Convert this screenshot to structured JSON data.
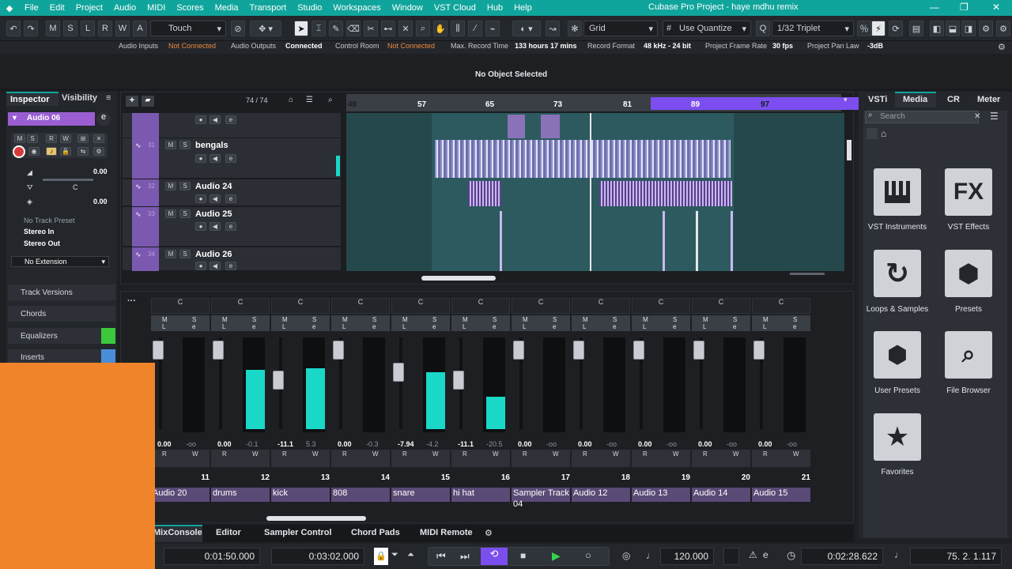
{
  "menu": [
    "File",
    "Edit",
    "Project",
    "Audio",
    "MIDI",
    "Scores",
    "Media",
    "Transport",
    "Studio",
    "Workspaces",
    "Window",
    "VST Cloud",
    "Hub",
    "Help"
  ],
  "window_title": "Cubase Pro Project - haye mdhu remix",
  "toolbar": {
    "ms_buttons": [
      "M",
      "S",
      "L",
      "R",
      "W",
      "A"
    ],
    "automation_mode": "Touch",
    "snap_type": "Grid",
    "quantize_mode": "Use Quantize",
    "quantize_value": "1/32 Triplet"
  },
  "status": {
    "audio_inputs_label": "Audio Inputs",
    "audio_inputs_value": "Not Connected",
    "audio_outputs_label": "Audio Outputs",
    "audio_outputs_value": "Connected",
    "control_room_label": "Control Room",
    "control_room_value": "Not Connected",
    "max_record_label": "Max. Record Time",
    "max_record_value": "133 hours 17 mins",
    "record_format_label": "Record Format",
    "record_format_value": "48 kHz - 24 bit",
    "frame_rate_label": "Project Frame Rate",
    "frame_rate_value": "30 fps",
    "pan_law_label": "Project Pan Law",
    "pan_law_value": "-3dB"
  },
  "info_line": "No Object Selected",
  "inspector": {
    "tab_inspector": "Inspector",
    "tab_visibility": "Visibility",
    "track_name": "Audio 06",
    "volume": "0.00",
    "pan_value": "C",
    "vol2": "0.00",
    "track_preset": "No Track Preset",
    "input": "Stereo In",
    "output": "Stereo Out",
    "extension": "No Extension",
    "sections": [
      "Track Versions",
      "Chords",
      "Equalizers",
      "Inserts"
    ]
  },
  "project": {
    "track_count": "74 / 74",
    "ruler_bars": [
      "49",
      "57",
      "65",
      "73",
      "81",
      "89",
      "97"
    ],
    "tracks": [
      {
        "name": "",
        "number": ""
      },
      {
        "name": "bengals",
        "number": "31"
      },
      {
        "name": "Audio 24",
        "number": "32"
      },
      {
        "name": "Audio 25",
        "number": "33"
      },
      {
        "name": "Audio 26",
        "number": "34"
      }
    ]
  },
  "mixer": {
    "channels": [
      {
        "name": "Audio 20",
        "number": "11",
        "pan": "C",
        "vol": "0.00",
        "peak": "-oo",
        "fader": 0.05,
        "level": 0.0
      },
      {
        "name": "drums",
        "number": "12",
        "pan": "C",
        "vol": "0.00",
        "peak": "-0.1",
        "fader": 0.05,
        "level": 0.65
      },
      {
        "name": "kick",
        "number": "13",
        "pan": "C",
        "vol": "-11.1",
        "peak": "5.3",
        "fader": 0.52,
        "level": 0.66
      },
      {
        "name": "808",
        "number": "14",
        "pan": "C",
        "vol": "0.00",
        "peak": "-0.3",
        "fader": 0.05,
        "level": 0.0
      },
      {
        "name": "snare",
        "number": "15",
        "pan": "C",
        "vol": "-7.94",
        "peak": "-4.2",
        "fader": 0.4,
        "level": 0.62
      },
      {
        "name": "hi hat",
        "number": "16",
        "pan": "C",
        "vol": "-11.1",
        "peak": "-20.5",
        "fader": 0.52,
        "level": 0.35
      },
      {
        "name": "Sampler Track 04",
        "number": "17",
        "pan": "C",
        "vol": "0.00",
        "peak": "-oo",
        "fader": 0.05,
        "level": 0.0
      },
      {
        "name": "Audio 12",
        "number": "18",
        "pan": "C",
        "vol": "0.00",
        "peak": "-oo",
        "fader": 0.05,
        "level": 0.0
      },
      {
        "name": "Audio 13",
        "number": "19",
        "pan": "C",
        "vol": "0.00",
        "peak": "-oo",
        "fader": 0.05,
        "level": 0.0
      },
      {
        "name": "Audio 14",
        "number": "20",
        "pan": "C",
        "vol": "0.00",
        "peak": "-oo",
        "fader": 0.05,
        "level": 0.0
      },
      {
        "name": "Audio 15",
        "number": "21",
        "pan": "C",
        "vol": "0.00",
        "peak": "-oo",
        "fader": 0.05,
        "level": 0.0
      }
    ]
  },
  "bottom_tabs": [
    "MixConsole",
    "Editor",
    "Sampler Control",
    "Chord Pads",
    "MIDI Remote"
  ],
  "transport": {
    "left_locator": "0:01:50.000",
    "right_locator": "0:03:02.000",
    "tempo": "120.000",
    "time_display": "0:02:28.622",
    "bars_display": "75. 2. 1.117"
  },
  "right_zone": {
    "tabs": [
      "VSTi",
      "Media",
      "CR",
      "Meter"
    ],
    "search_placeholder": "Search",
    "tiles": [
      {
        "label": "VST Instruments",
        "icon": "piano-icon"
      },
      {
        "label": "VST Effects",
        "icon": "fx-icon"
      },
      {
        "label": "Loops & Samples",
        "icon": "loop-icon"
      },
      {
        "label": "Presets",
        "icon": "hexagon-icon"
      },
      {
        "label": "User Presets",
        "icon": "user-icon"
      },
      {
        "label": "File Browser",
        "icon": "folder-search-icon"
      },
      {
        "label": "Favorites",
        "icon": "star-icon"
      }
    ]
  },
  "colors": {
    "accent_teal": "#10a59c",
    "cycle_purple": "#7c4ef0",
    "meter_cyan": "#19d8c8",
    "overlay_orange": "#f0842a"
  }
}
